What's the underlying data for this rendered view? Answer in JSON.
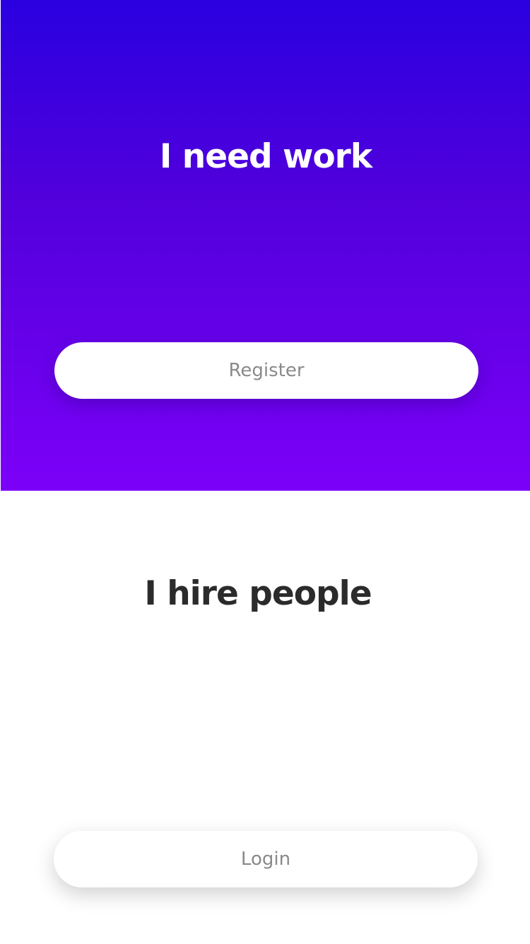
{
  "worker": {
    "title": "I need work",
    "register_label": "Register"
  },
  "employer": {
    "title": "I hire people",
    "login_label": "Login"
  },
  "colors": {
    "gradient_top": "#2a00e0",
    "gradient_bottom": "#7c00f8",
    "dark_text": "#2b2b2b",
    "button_text": "#8a8a8a"
  }
}
